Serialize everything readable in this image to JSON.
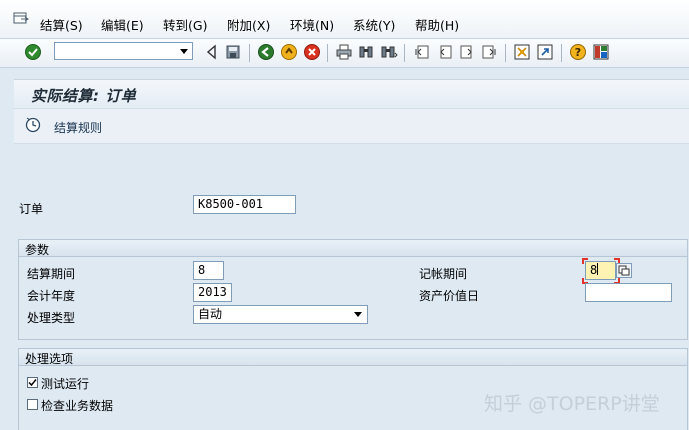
{
  "menu": {
    "items": [
      "结算(S)",
      "编辑(E)",
      "转到(G)",
      "附加(X)",
      "环境(N)",
      "系统(Y)",
      "帮助(H)"
    ]
  },
  "toolbar": {
    "command_field_value": "",
    "buttons": [
      "enter-icon",
      "back-icon",
      "save-icon",
      "back-green-icon",
      "exit-icon",
      "cancel-icon",
      "print-icon",
      "find-icon",
      "find-next-icon",
      "first-page-icon",
      "previous-page-icon",
      "next-page-icon",
      "last-page-icon",
      "create-session-icon",
      "shortcut-icon",
      "help-icon",
      "layout-icon"
    ]
  },
  "title": "实际结算: 订单",
  "app_toolbar": {
    "rule_label": "结算规则"
  },
  "form": {
    "order_label": "订单",
    "order_value": "K8500-001",
    "params": {
      "title": "参数",
      "settlement_period_label": "结算期间",
      "settlement_period_value": "8",
      "fiscal_year_label": "会计年度",
      "fiscal_year_value": "2013",
      "processing_type_label": "处理类型",
      "processing_type_value": "自动",
      "posting_period_label": "记帐期间",
      "posting_period_value": "8",
      "asset_value_date_label": "资产价值日",
      "asset_value_date_value": ""
    },
    "options": {
      "title": "处理选项",
      "test_run_label": "测试运行",
      "test_run_checked": true,
      "check_trans_label": "检查业务数据",
      "check_trans_checked": false
    }
  },
  "watermark": "知乎 @TOPERP讲堂",
  "colors": {
    "background": "#dfe9f2",
    "focus_field": "#fff3b3",
    "focus_marker": "#e0332b",
    "field_border": "#7f9db9"
  }
}
